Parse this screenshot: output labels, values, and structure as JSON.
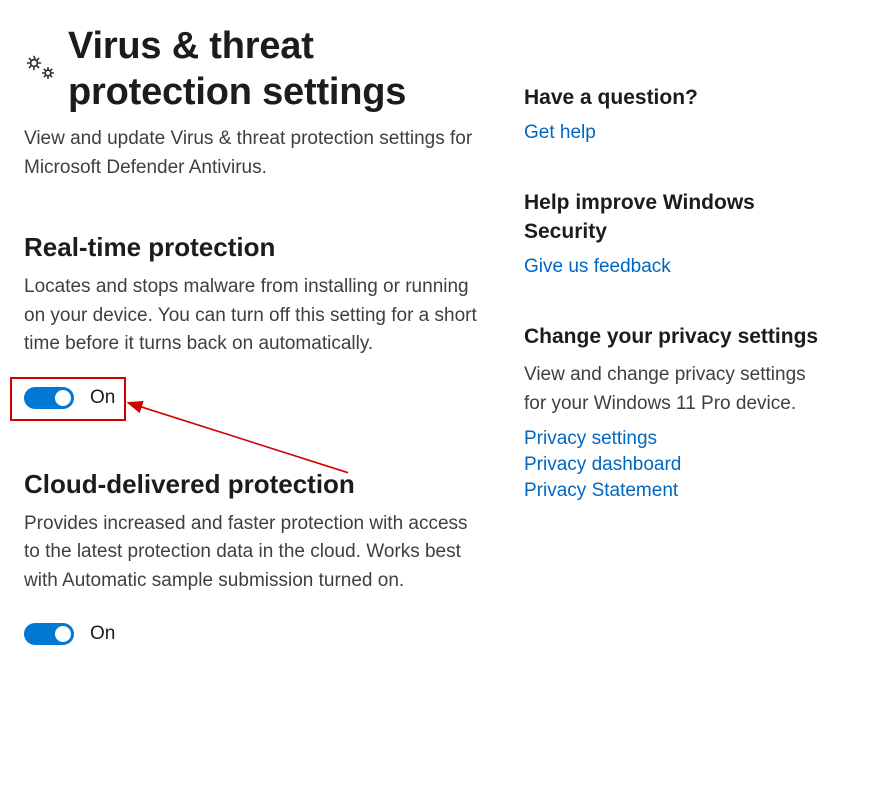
{
  "header": {
    "title": "Virus & threat protection settings",
    "subtitle": "View and update Virus & threat protection settings for Microsoft Defender Antivirus."
  },
  "sections": {
    "realtime": {
      "title": "Real-time protection",
      "description": "Locates and stops malware from installing or running on your device. You can turn off this setting for a short time before it turns back on automatically.",
      "toggle_state": "On"
    },
    "cloud": {
      "title": "Cloud-delivered protection",
      "description": "Provides increased and faster protection with access to the latest protection data in the cloud. Works best with Automatic sample submission turned on.",
      "toggle_state": "On"
    }
  },
  "sidebar": {
    "question": {
      "title": "Have a question?",
      "link": "Get help"
    },
    "improve": {
      "title": "Help improve Windows Security",
      "link": "Give us feedback"
    },
    "privacy": {
      "title": "Change your privacy settings",
      "text": "View and change privacy settings for your Windows 11 Pro device.",
      "links": [
        "Privacy settings",
        "Privacy dashboard",
        "Privacy Statement"
      ]
    }
  },
  "annotation": {
    "highlight_target": "realtime-toggle",
    "color": "#d20000"
  }
}
